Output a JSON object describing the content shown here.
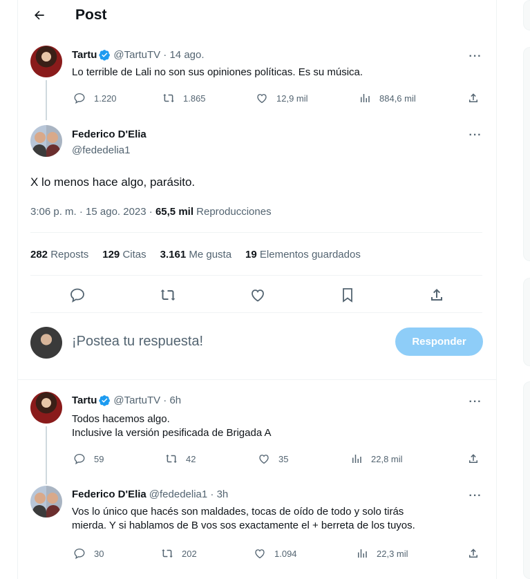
{
  "header": {
    "title": "Post"
  },
  "quoted_tweet": {
    "name": "Tartu",
    "meta": "@TartuTV · 14 ago.",
    "text": "Lo terrible de Lali no son sus opiniones políticas. Es su música.",
    "replies": "1.220",
    "reposts": "1.865",
    "likes": "12,9 mil",
    "views": "884,6 mil"
  },
  "main_tweet": {
    "name": "Federico D'Elia",
    "handle": "@fededelia1",
    "text": "X lo menos hace algo, parásito.",
    "time": "3:06 p. m. · 15 ago. 2023 · ",
    "views_count": "65,5 mil",
    "views_label": " Reproducciones",
    "stats": {
      "reposts_count": "282",
      "reposts_label": "Reposts",
      "quotes_count": "129",
      "quotes_label": "Citas",
      "likes_count": "3.161",
      "likes_label": "Me gusta",
      "bookmarks_count": "19",
      "bookmarks_label": "Elementos guardados"
    }
  },
  "composer": {
    "placeholder": "¡Postea tu respuesta!",
    "button": "Responder"
  },
  "replies": [
    {
      "name": "Tartu",
      "meta": "@TartuTV · 6h",
      "text": "Todos hacemos algo.\n Inclusive la versión pesificada de Brigada A",
      "replies": "59",
      "reposts": "42",
      "likes": "35",
      "views": "22,8 mil"
    },
    {
      "name": "Federico D'Elia",
      "meta": "@fededelia1 · 3h",
      "text": "Vos lo único que hacés son maldades, tocas de oído de todo y solo tirás\nmierda. Y si hablamos de B vos sos exactamente el + berreta de los tuyos.",
      "replies": "30",
      "reposts": "202",
      "likes": "1.094",
      "views": "22,3 mil"
    }
  ],
  "colors": {
    "accent": "#1d9bf0",
    "button_disabled": "#8ecdf8",
    "muted": "#536471"
  }
}
